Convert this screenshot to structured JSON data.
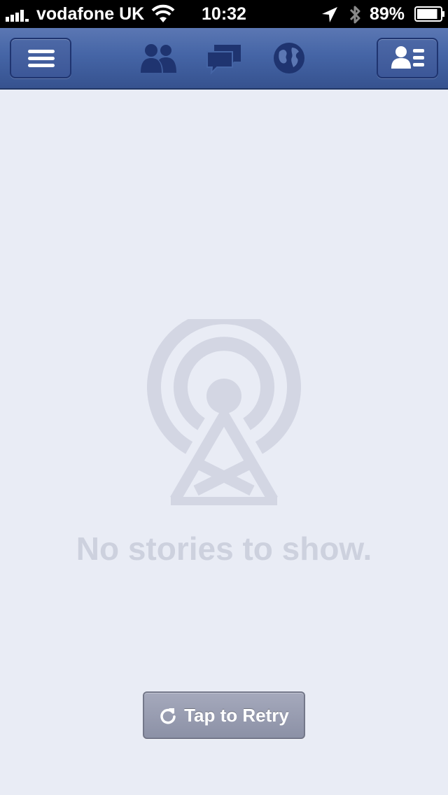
{
  "status_bar": {
    "carrier": "vodafone UK",
    "time": "10:32",
    "battery_percent": "89%",
    "battery_level": 0.89,
    "signal_bars": 4
  },
  "nav_bar": {
    "left_button_icon": "menu-icon",
    "right_button_icon": "contacts-list-icon",
    "center_icons": [
      "friend-requests-icon",
      "messages-icon",
      "notifications-globe-icon"
    ]
  },
  "main": {
    "empty_icon": "broadcast-tower-icon",
    "empty_message": "No stories to show.",
    "retry_label": "Tap to Retry",
    "retry_icon": "refresh-icon"
  },
  "colors": {
    "nav_blue": "#4565a6",
    "background": "#e9ecf5",
    "placeholder_gray": "#cdd1de",
    "retry_button": "#9a9eb2"
  }
}
